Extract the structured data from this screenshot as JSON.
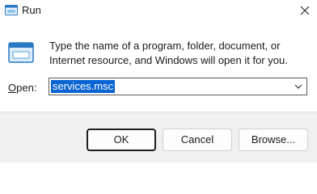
{
  "window": {
    "title": "Run"
  },
  "dialog": {
    "description": "Type the name of a program, folder, document, or Internet resource, and Windows will open it for you.",
    "open_label_first": "O",
    "open_label_rest": "pen:",
    "open_value": "services.msc"
  },
  "buttons": {
    "ok": "OK",
    "cancel": "Cancel",
    "browse": "Browse..."
  },
  "icons": {
    "app": "run-icon",
    "close": "close-icon",
    "dropdown": "chevron-down-icon"
  },
  "colors": {
    "selection": "#0a64d2",
    "footer_bg": "#f0f0f0",
    "accent": "#1a7ecb"
  }
}
